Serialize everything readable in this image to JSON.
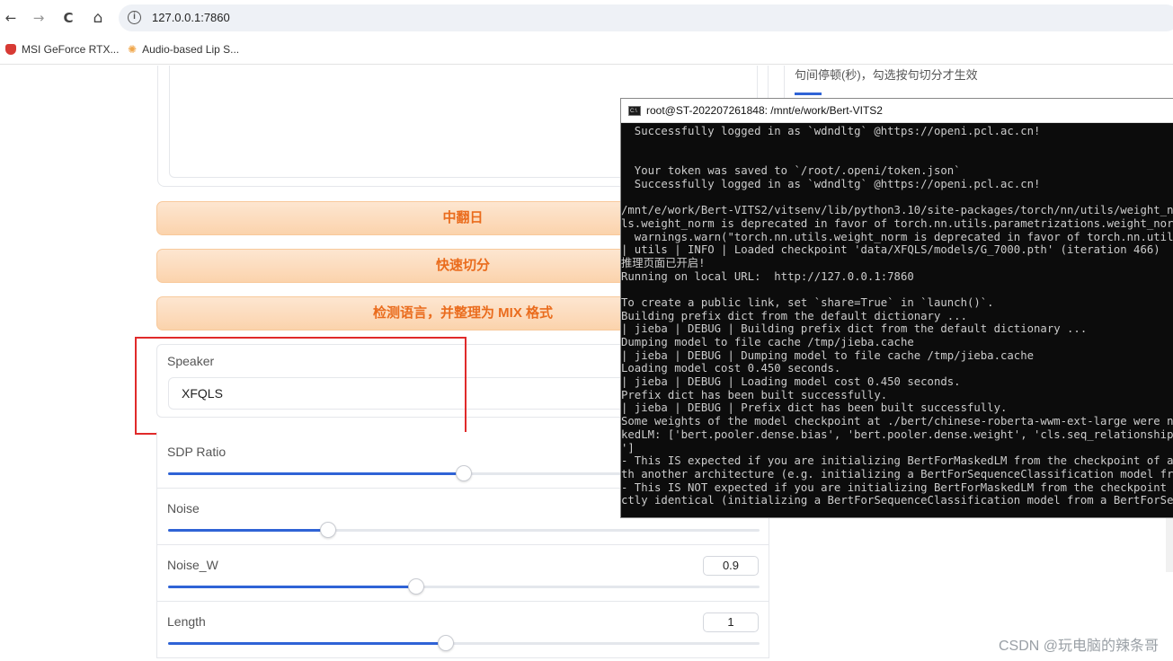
{
  "browser": {
    "nav": {
      "back": "←",
      "forward": "→",
      "reload": "C",
      "home": "⌂"
    },
    "info_icon": "i",
    "url": "127.0.0.1:7860",
    "bookmarks": [
      {
        "label": "MSI GeForce RTX...",
        "icon": "shield-icon"
      },
      {
        "label": "Audio-based Lip S...",
        "icon": "sparkle-icon"
      }
    ]
  },
  "main": {
    "right_hint": "句间停顿(秒)，勾选按句切分才生效",
    "buttons": {
      "translate": "中翻日",
      "quick_split": "快速切分",
      "detect_language": "检测语言，并整理为 MIX 格式"
    },
    "speaker": {
      "label": "Speaker",
      "value": "XFQLS"
    },
    "sliders": [
      {
        "label": "SDP Ratio",
        "value": "",
        "fraction": 0.5
      },
      {
        "label": "Noise",
        "value": "",
        "fraction": 0.27
      },
      {
        "label": "Noise_W",
        "value": "0.9",
        "fraction": 0.42
      },
      {
        "label": "Length",
        "value": "1",
        "fraction": 0.47
      }
    ]
  },
  "terminal": {
    "title": "root@ST-202207261848: /mnt/e/work/Bert-VITS2",
    "lines": [
      "  Successfully logged in as `wdndltg` @https://openi.pcl.ac.cn!",
      "",
      "",
      "  Your token was saved to `/root/.openi/token.json`",
      "  Successfully logged in as `wdndltg` @https://openi.pcl.ac.cn!",
      "",
      "/mnt/e/work/Bert-VITS2/vitsenv/lib/python3.10/site-packages/torch/nn/utils/weight_no",
      "ls.weight_norm is deprecated in favor of torch.nn.utils.parametrizations.weight_norm",
      "  warnings.warn(\"torch.nn.utils.weight_norm is deprecated in favor of torch.nn.utils",
      "| utils | INFO | Loaded checkpoint 'data/XFQLS/models/G_7000.pth' (iteration 466)",
      "推理页面已开启!",
      "Running on local URL:  http://127.0.0.1:7860",
      "",
      "To create a public link, set `share=True` in `launch()`.",
      "Building prefix dict from the default dictionary ...",
      "| jieba | DEBUG | Building prefix dict from the default dictionary ...",
      "Dumping model to file cache /tmp/jieba.cache",
      "| jieba | DEBUG | Dumping model to file cache /tmp/jieba.cache",
      "Loading model cost 0.450 seconds.",
      "| jieba | DEBUG | Loading model cost 0.450 seconds.",
      "Prefix dict has been built successfully.",
      "| jieba | DEBUG | Prefix dict has been built successfully.",
      "Some weights of the model checkpoint at ./bert/chinese-roberta-wwm-ext-large were no",
      "kedLM: ['bert.pooler.dense.bias', 'bert.pooler.dense.weight', 'cls.seq_relationship.",
      "']",
      "- This IS expected if you are initializing BertForMaskedLM from the checkpoint of a",
      "th another architecture (e.g. initializing a BertForSequenceClassification model fro",
      "- This IS NOT expected if you are initializing BertForMaskedLM from the checkpoint o",
      "ctly identical (initializing a BertForSequenceClassification model from a BertForSeq"
    ]
  },
  "watermark": "CSDN @玩电脑的辣条哥",
  "colors": {
    "accent": "#2f63d6",
    "orange_text": "#ea6c1d",
    "highlight_red": "#e02a2a"
  }
}
